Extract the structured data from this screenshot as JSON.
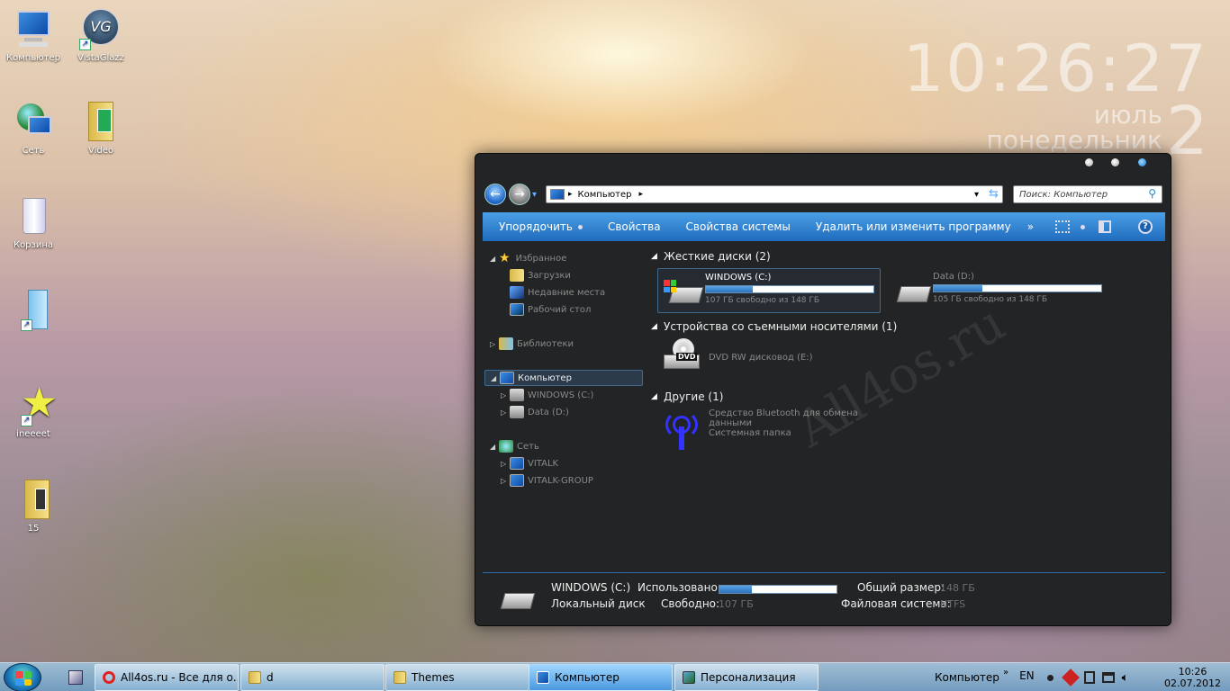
{
  "desktop": {
    "icons": [
      {
        "label": "Компьютер"
      },
      {
        "label": "VistaGlazz"
      },
      {
        "label": "Сеть"
      },
      {
        "label": "Video"
      },
      {
        "label": "Корзина"
      },
      {
        "label": ""
      },
      {
        "label": "ineeeet"
      },
      {
        "label": "15"
      }
    ],
    "vg_text": "VG",
    "shortcut_arrow": "↗"
  },
  "clock_widget": {
    "time": "10:26:27",
    "month": "июль",
    "weekday": "понедельник",
    "day": "2"
  },
  "watermark": "All4os.ru",
  "explorer": {
    "address": {
      "flag": "▸",
      "text": "Компьютер",
      "chevron": "▸",
      "dropdown": "▾",
      "refresh": "⇆"
    },
    "search_placeholder": "Поиск: Компьютер",
    "nav": {
      "back": "←",
      "forward": "→",
      "history": "▾"
    },
    "toolbar": {
      "organize": "Упорядочить",
      "properties": "Свойства",
      "system_properties": "Свойства системы",
      "uninstall": "Удалить или изменить программу",
      "more": "»",
      "help": "?"
    },
    "tree": {
      "favorites": "Избранное",
      "downloads": "Загрузки",
      "recent": "Недавние места",
      "desktop": "Рабочий стол",
      "libraries": "Библиотеки",
      "computer": "Компьютер",
      "drive_c": "WINDOWS (C:)",
      "drive_d": "Data (D:)",
      "network": "Сеть",
      "net1": "VITALK",
      "net2": "VITALK-GROUP",
      "expanded": "◢",
      "collapsed": "▷"
    },
    "groups": {
      "hdd": "Жесткие диски (2)",
      "removable": "Устройства со съемными носителями (1)",
      "other": "Другие (1)"
    },
    "drives": [
      {
        "name": "WINDOWS (C:)",
        "free": "107 ГБ свободно из 148 ГБ",
        "used_fraction": 0.28
      },
      {
        "name": "Data (D:)",
        "free": "105 ГБ свободно из 148 ГБ",
        "used_fraction": 0.29
      }
    ],
    "dvd": {
      "name": "DVD RW дисковод (E:)",
      "badge": "DVD"
    },
    "bluetooth": {
      "name": "Средство Bluetooth для обмена данными",
      "type": "Системная папка"
    },
    "details": {
      "name": "WINDOWS (C:)",
      "type": "Локальный диск",
      "used_label": "Использовано:",
      "free_label": "Свободно:",
      "free_value": "107 ГБ",
      "total_label": "Общий размер:",
      "total_value": "148 ГБ",
      "fs_label": "Файловая система:",
      "fs_value": "NTFS",
      "used_fraction": 0.28
    }
  },
  "taskbar": {
    "items": [
      {
        "label": "All4os.ru - Все для о..."
      },
      {
        "label": "d"
      },
      {
        "label": "Themes"
      },
      {
        "label": "Компьютер"
      },
      {
        "label": "Персонализация"
      }
    ],
    "location": "Компьютер",
    "chevron": "»",
    "lang": "EN",
    "time": "10:26",
    "date": "02.07.2012"
  }
}
